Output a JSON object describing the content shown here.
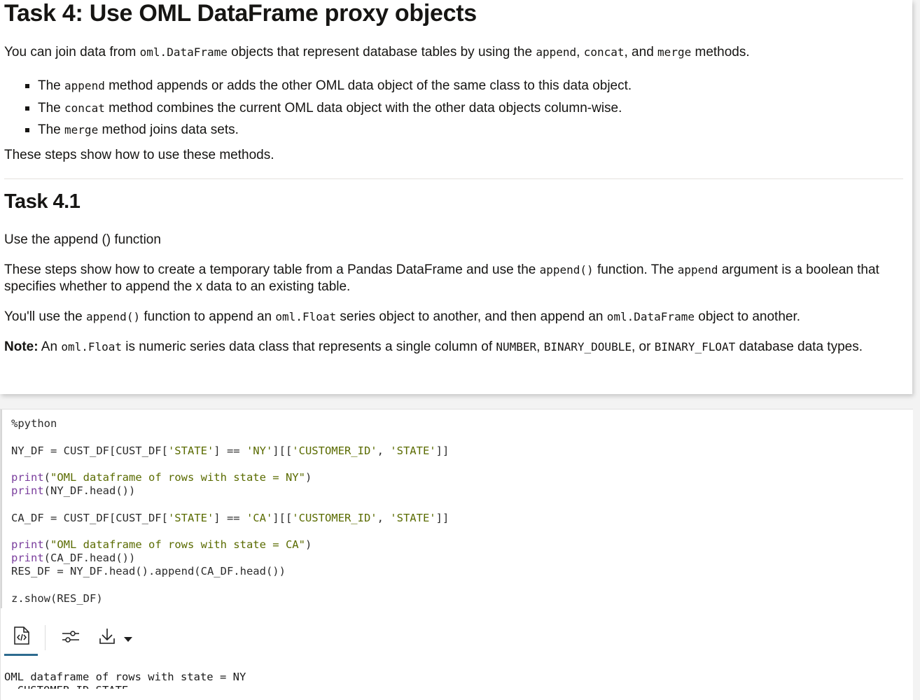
{
  "task": {
    "title": "Task 4: Use OML DataFrame proxy objects",
    "intro": {
      "t1": "You can join data from ",
      "c1": "oml.DataFrame",
      "t2": " objects that represent database tables by using the ",
      "c2": "append",
      "t3": ", ",
      "c3": "concat",
      "t4": ", and ",
      "c4": "merge",
      "t5": " methods."
    },
    "bullets": [
      {
        "pre": "The ",
        "code": "append",
        "post": " method appends or adds the other OML data object of the same class to this data object."
      },
      {
        "pre": "The ",
        "code": "concat",
        "post": " method combines the current OML data object with the other data objects column-wise."
      },
      {
        "pre": "The ",
        "code": "merge",
        "post": " method joins data sets."
      }
    ],
    "steps_text": "These steps show how to use these methods."
  },
  "subtask": {
    "title": "Task 4.1",
    "subtitle": "Use the append () function",
    "p1": {
      "t1": "These steps show how to create a temporary table from a Pandas DataFrame and use the ",
      "c1": "append()",
      "t2": " function. The ",
      "c2": "append",
      "t3": " argument is a boolean that specifies whether to append the x data to an existing table."
    },
    "p2": {
      "t1": "You'll use the ",
      "c1": "append()",
      "t2": " function to append an ",
      "c2": "oml.Float",
      "t3": " series object to another, and then append an ",
      "c3": "oml.DataFrame",
      "t4": " object to another."
    },
    "note": {
      "label": "Note:",
      "t1": " An ",
      "c1": "oml.Float",
      "t2": " is numeric series data class that represents a single column of ",
      "c2": "NUMBER",
      "t3": ", ",
      "c3": "BINARY_DOUBLE",
      "t4": ", or ",
      "c4": "BINARY_FLOAT",
      "t5": " database data types."
    }
  },
  "code": {
    "magic": "%python",
    "l1a": "NY_DF = CUST_DF[CUST_DF[",
    "l1b": "'STATE'",
    "l1c": "] == ",
    "l1d": "'NY'",
    "l1e": "][[",
    "l1f": "'CUSTOMER_ID'",
    "l1g": ", ",
    "l1h": "'STATE'",
    "l1i": "]]",
    "print_kw": "print",
    "p1_str": "\"OML dataframe of rows with state = NY\"",
    "p2_arg": "(NY_DF.head())",
    "l2a": "CA_DF = CUST_DF[CUST_DF[",
    "l2b": "'STATE'",
    "l2c": "] == ",
    "l2d": "'CA'",
    "l2e": "][[",
    "l2f": "'CUSTOMER_ID'",
    "l2g": ", ",
    "l2h": "'STATE'",
    "l2i": "]]",
    "p3_str": "\"OML dataframe of rows with state = CA\"",
    "p4_arg": "(CA_DF.head())",
    "res": "RES_DF = NY_DF.head().append(CA_DF.head())",
    "show": "z.show(RES_DF)"
  },
  "toolbar": {
    "icons": [
      "code-file-icon",
      "sliders-icon",
      "download-icon",
      "caret-down-icon"
    ]
  },
  "output": {
    "line1": "OML dataframe of rows with state = NY",
    "line2": "  CUSTOMER_ID STATE"
  },
  "colors": {
    "keyword": "#7a3e9d",
    "string": "#5a6b00",
    "accent": "#2d6b8f"
  }
}
